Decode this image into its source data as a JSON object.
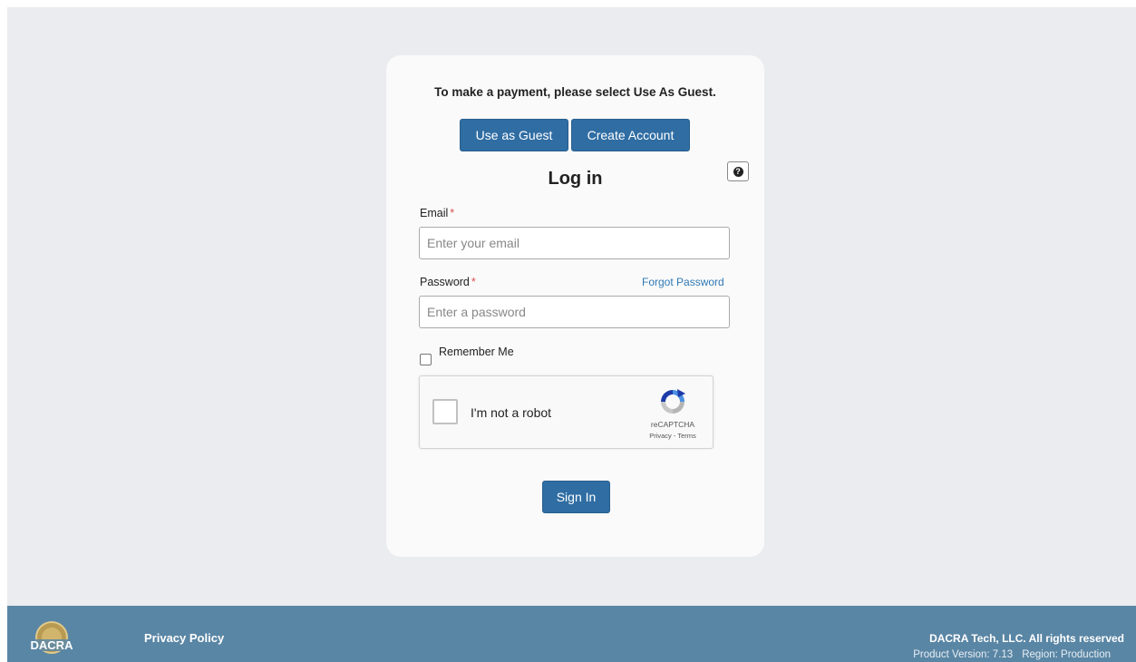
{
  "guest_message": "To make a payment, please select Use As Guest.",
  "buttons": {
    "use_as_guest": "Use as Guest",
    "create_account": "Create Account",
    "sign_in": "Sign In"
  },
  "login": {
    "title": "Log in",
    "help_icon": "question-circle-icon",
    "email": {
      "label": "Email",
      "required_marker": "*",
      "placeholder": "Enter your email",
      "value": ""
    },
    "password": {
      "label": "Password",
      "required_marker": "*",
      "placeholder": "Enter a password",
      "value": "",
      "forgot_link": "Forgot Password"
    },
    "remember_me": {
      "label": "Remember Me",
      "checked": false
    }
  },
  "recaptcha": {
    "label": "I'm not a robot",
    "brand": "reCAPTCHA",
    "privacy": "Privacy",
    "separator": "-",
    "terms": "Terms",
    "checked": false
  },
  "footer": {
    "logo_text": "DACRA",
    "privacy_policy": "Privacy Policy",
    "copyright": "DACRA Tech, LLC. All rights reserved",
    "product_version": "Product Version: 7.13",
    "region": "Region: Production"
  },
  "colors": {
    "page_background": "#eaecef",
    "card_background": "#fafafa",
    "button": "#2f6da3",
    "link": "#2f78b5",
    "required": "#d9534f",
    "footer": "#5a86a5"
  }
}
